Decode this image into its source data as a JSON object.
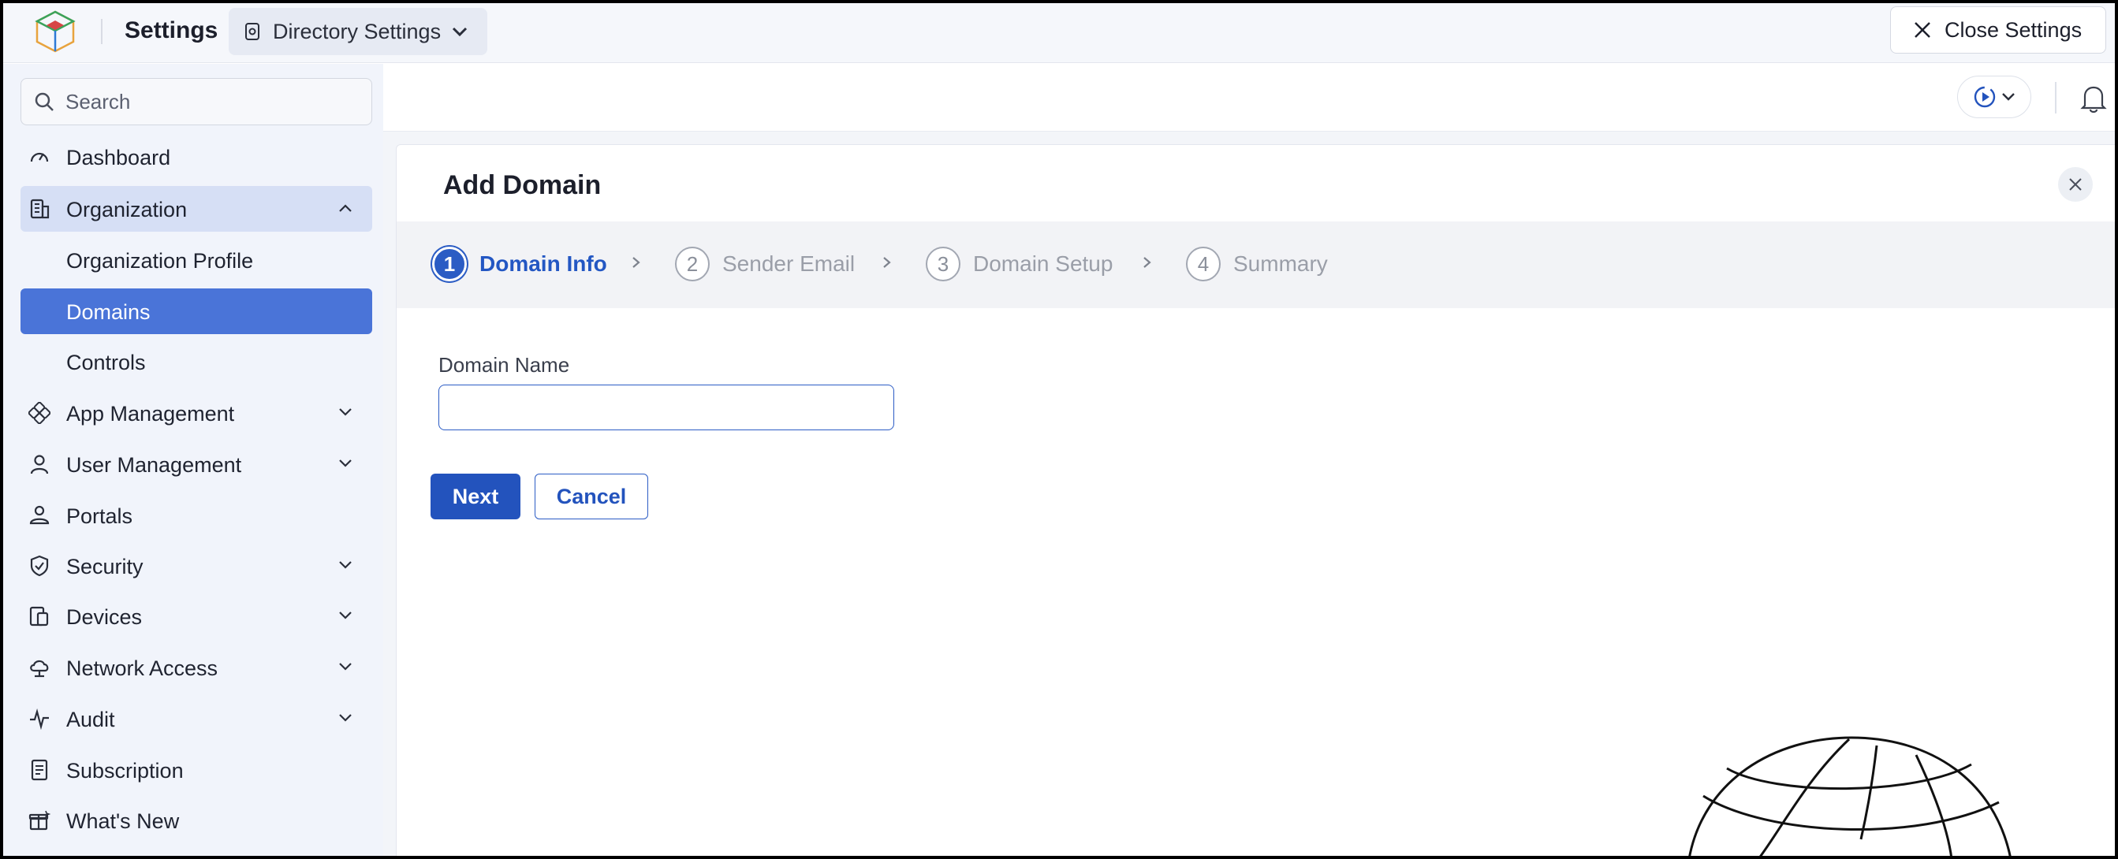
{
  "header": {
    "title": "Settings",
    "directory_dropdown": "Directory Settings",
    "close_label": "Close Settings"
  },
  "sidebar": {
    "search_placeholder": "Search",
    "items": [
      {
        "label": "Dashboard",
        "icon": "gauge-icon"
      },
      {
        "label": "Organization",
        "icon": "building-icon",
        "expanded": true
      },
      {
        "label": "Organization Profile",
        "sub": true
      },
      {
        "label": "Domains",
        "sub": true,
        "active": true
      },
      {
        "label": "Controls",
        "sub": true
      },
      {
        "label": "App Management",
        "icon": "apps-icon"
      },
      {
        "label": "User Management",
        "icon": "user-icon"
      },
      {
        "label": "Portals",
        "icon": "portal-icon"
      },
      {
        "label": "Security",
        "icon": "shield-icon"
      },
      {
        "label": "Devices",
        "icon": "devices-icon"
      },
      {
        "label": "Network Access",
        "icon": "cloud-icon"
      },
      {
        "label": "Audit",
        "icon": "pulse-icon"
      },
      {
        "label": "Subscription",
        "icon": "receipt-icon"
      },
      {
        "label": "What's New",
        "icon": "gift-icon"
      }
    ]
  },
  "panel": {
    "title": "Add Domain",
    "steps": [
      {
        "num": "1",
        "label": "Domain Info",
        "current": true
      },
      {
        "num": "2",
        "label": "Sender Email"
      },
      {
        "num": "3",
        "label": "Domain Setup"
      },
      {
        "num": "4",
        "label": "Summary"
      }
    ],
    "field_label": "Domain Name",
    "field_value": "",
    "next_label": "Next",
    "cancel_label": "Cancel"
  },
  "colors": {
    "accent": "#2353bd",
    "active_nav": "#4a74d8",
    "expanded_nav": "#d6dff5",
    "sidebar_bg": "#f1f4fb"
  }
}
